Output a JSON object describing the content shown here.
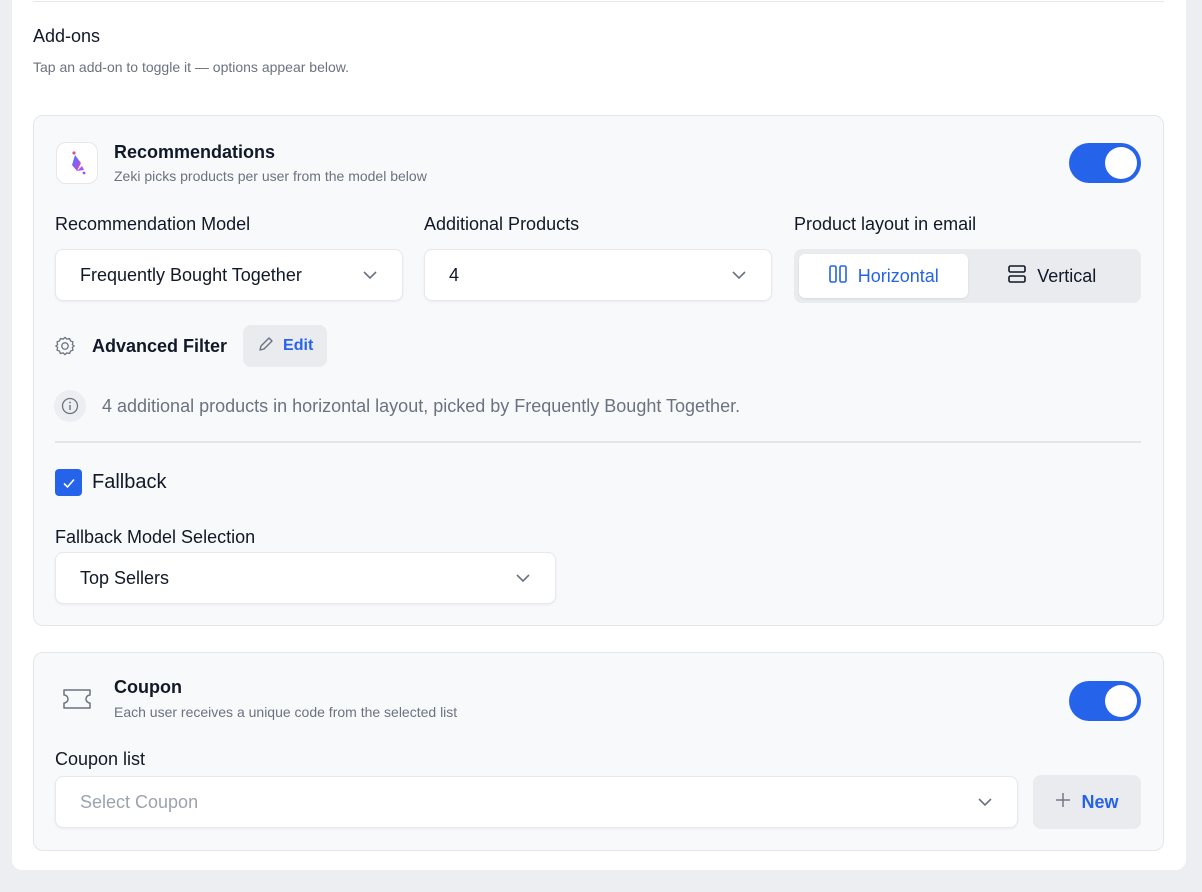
{
  "addons": {
    "title": "Add-ons",
    "subtitle": "Tap an add-on to toggle it — options appear below."
  },
  "recommendations": {
    "icon": "sparkle-app-icon",
    "title": "Recommendations",
    "subtitle": "Zeki picks products per user from the model below",
    "enabled": true,
    "model_label": "Recommendation Model",
    "model_value": "Frequently Bought Together",
    "additional_label": "Additional Products",
    "additional_value": "4",
    "layout_label": "Product layout in email",
    "layout_options": [
      "Horizontal",
      "Vertical"
    ],
    "layout_selected": "Horizontal",
    "advanced_filter_label": "Advanced Filter",
    "edit_label": "Edit",
    "info_text": "4 additional products in horizontal layout, picked by Frequently Bought Together.",
    "fallback_label": "Fallback",
    "fallback_checked": true,
    "fallback_model_label": "Fallback Model Selection",
    "fallback_model_value": "Top Sellers"
  },
  "coupon": {
    "icon": "ticket-icon",
    "title": "Coupon",
    "subtitle": "Each user receives a unique code from the selected list",
    "enabled": true,
    "list_label": "Coupon list",
    "list_placeholder": "Select Coupon",
    "new_label": "New"
  },
  "colors": {
    "accent": "#2563eb",
    "card_bg": "#f8f9fb",
    "muted_text": "#6b7280"
  }
}
